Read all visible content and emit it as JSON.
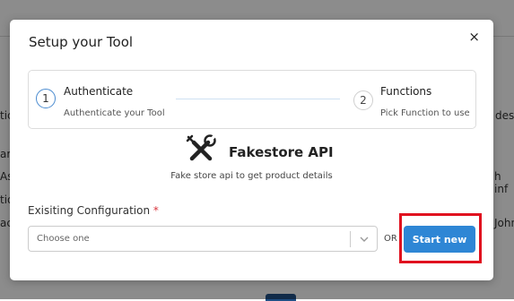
{
  "background": {
    "fragments": [
      "tic",
      "ar",
      "Ass",
      "tio",
      "ac",
      "desi",
      "h inf",
      "John"
    ]
  },
  "modal": {
    "title": "Setup your Tool",
    "close_label": "×"
  },
  "stepper": {
    "steps": [
      {
        "number": "1",
        "title": "Authenticate",
        "subtitle": "Authenticate your Tool",
        "active": true
      },
      {
        "number": "2",
        "title": "Functions",
        "subtitle": "Pick Function to use",
        "active": false
      }
    ]
  },
  "tool": {
    "name": "Fakestore API",
    "description": "Fake store api to get product details",
    "icon": "tools-icon"
  },
  "config": {
    "label": "Exisiting Configuration",
    "required_mark": "*",
    "placeholder": "Choose one",
    "or_text": "OR",
    "start_button": "Start new"
  },
  "colors": {
    "primary": "#2e86d5",
    "highlight": "#e0111f",
    "required": "#d9363e"
  }
}
